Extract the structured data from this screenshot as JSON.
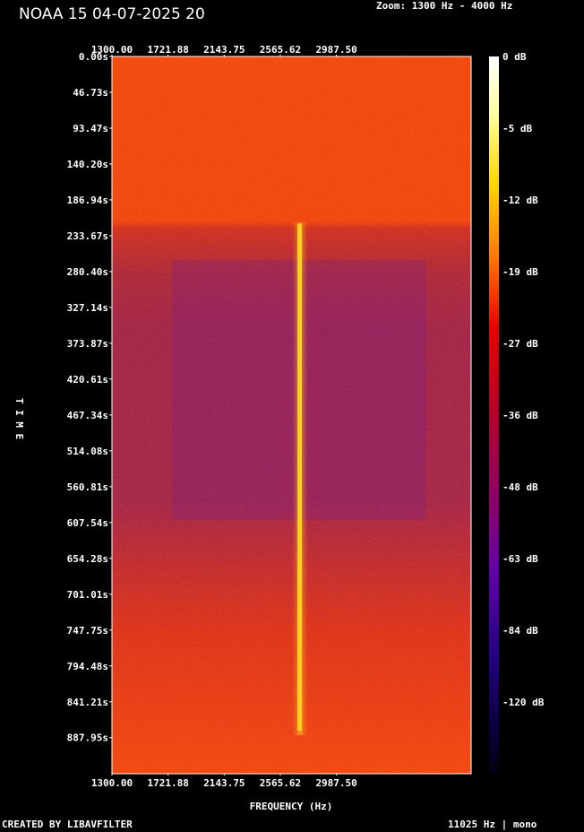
{
  "header": {
    "title": "NOAA 15 04-07-2025 20",
    "zoom": "Zoom: 1300 Hz - 4000 Hz"
  },
  "footer": {
    "created_by": "CREATED BY LIBAVFILTER",
    "sample_info": "11025 Hz | mono"
  },
  "chart_data": {
    "type": "heatmap",
    "title": "NOAA 15 04-07-2025 20",
    "xlabel": "FREQUENCY (Hz)",
    "ylabel": "TIME",
    "x_ticks": [
      "1300.00",
      "1721.88",
      "2143.75",
      "2565.62",
      "2987.50"
    ],
    "x_tick_values": [
      1300.0,
      1721.88,
      2143.75,
      2565.62,
      2987.5
    ],
    "xlim": [
      1300,
      4000
    ],
    "y_ticks": [
      "0.00s",
      "46.73s",
      "93.47s",
      "140.20s",
      "186.94s",
      "233.67s",
      "280.40s",
      "327.14s",
      "373.87s",
      "420.61s",
      "467.34s",
      "514.08s",
      "560.81s",
      "607.54s",
      "654.28s",
      "701.01s",
      "747.75s",
      "794.48s",
      "841.21s",
      "887.95s"
    ],
    "ylim": [
      0,
      935
    ],
    "colorbar": {
      "labels": [
        "0 dB",
        "-5 dB",
        "-12 dB",
        "-19 dB",
        "-27 dB",
        "-36 dB",
        "-48 dB",
        "-63 dB",
        "-84 dB",
        "-120 dB"
      ],
      "colors": [
        "#ffffff",
        "#ffff80",
        "#ffd000",
        "#ff7000",
        "#e00000",
        "#b0002a",
        "#8a0064",
        "#6a00a0",
        "#2a0080",
        "#000020"
      ]
    },
    "carrier_frequency_hz": 2400,
    "carrier_time_range_s": [
      220,
      870
    ]
  }
}
